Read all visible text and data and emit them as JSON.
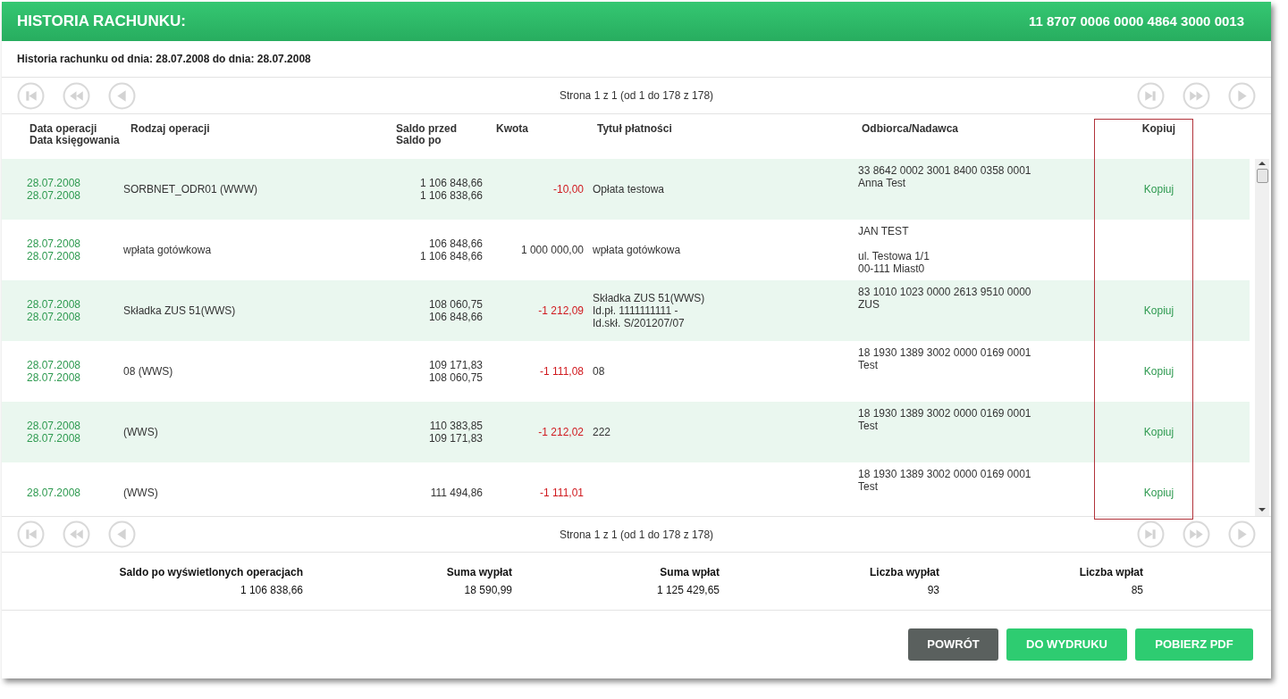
{
  "header": {
    "title": "HISTORIA RACHUNKU:",
    "account": "11 8707 0006 0000 4864 3000 0013"
  },
  "period": "Historia rachunku od dnia: 28.07.2008 do dnia: 28.07.2008",
  "pager_top": {
    "label": "Strona 1 z 1 (od 1 do 178 z 178)"
  },
  "table": {
    "columns": [
      [
        "Data operacji",
        "Data księgowania"
      ],
      [
        "Rodzaj operacji"
      ],
      [
        "Saldo przed",
        "Saldo po"
      ],
      [
        "Kwota"
      ],
      [
        "Tytuł płatności"
      ],
      [
        "Odbiorca/Nadawca"
      ],
      [
        "Kopiuj"
      ]
    ],
    "rows": [
      {
        "dates": [
          "28.07.2008",
          "28.07.2008"
        ],
        "type": "SORBNET_ODR01 (WWW)",
        "balances": [
          "1 106 848,66",
          "1 106 838,66"
        ],
        "amount": "-10,00",
        "debit": true,
        "title": [
          "Opłata testowa"
        ],
        "party": [
          [
            "33 8642 0002 3001 8400 0358 0001",
            "Anna Test"
          ]
        ],
        "copy": "Kopiuj"
      },
      {
        "dates": [
          "28.07.2008",
          "28.07.2008"
        ],
        "type": "wpłata gotówkowa",
        "balances": [
          "106 848,66",
          "1 106 848,66"
        ],
        "amount": "1 000 000,00",
        "debit": false,
        "title": [
          "wpłata gotówkowa"
        ],
        "party": [
          [
            "JAN TEST"
          ],
          [
            "ul. Testowa 1/1",
            "00-111 Miast0"
          ]
        ]
      },
      {
        "dates": [
          "28.07.2008",
          "28.07.2008"
        ],
        "type": "Składka ZUS 51(WWS)",
        "balances": [
          "108 060,75",
          "106 848,66"
        ],
        "amount": "-1 212,09",
        "debit": true,
        "title": [
          "Składka ZUS 51(WWS)",
          "Id.pł. 1111111111 -",
          "Id.skł. S/201207/07"
        ],
        "party": [
          [
            "83 1010 1023 0000 2613 9510 0000",
            "ZUS"
          ]
        ],
        "copy": "Kopiuj"
      },
      {
        "dates": [
          "28.07.2008",
          "28.07.2008"
        ],
        "type": "08 (WWS)",
        "balances": [
          "109 171,83",
          "108 060,75"
        ],
        "amount": "-1 111,08",
        "debit": true,
        "title": [
          "08"
        ],
        "party": [
          [
            "18 1930 1389 3002 0000 0169 0001",
            "Test"
          ]
        ],
        "copy": "Kopiuj"
      },
      {
        "dates": [
          "28.07.2008",
          "28.07.2008"
        ],
        "type": "(WWS)",
        "balances": [
          "110 383,85",
          "109 171,83"
        ],
        "amount": "-1 212,02",
        "debit": true,
        "title": [
          "222"
        ],
        "party": [
          [
            "18 1930 1389 3002 0000 0169 0001",
            "Test"
          ]
        ],
        "copy": "Kopiuj"
      },
      {
        "dates": [
          "28.07.2008"
        ],
        "type": "(WWS)",
        "balances": [
          "111 494,86"
        ],
        "amount": "-1 111,01",
        "debit": true,
        "party": [
          [
            "18 1930 1389 3002 0000 0169 0001",
            "Test"
          ]
        ],
        "copy": "Kopiuj"
      }
    ]
  },
  "pager_bottom": {
    "label": "Strona 1 z 1 (od 1 do 178 z 178)"
  },
  "summary": [
    {
      "label": "Saldo po wyświetlonych operacjach",
      "value": "1 106 838,66"
    },
    {
      "label": "Suma wypłat",
      "value": "18 590,99"
    },
    {
      "label": "Suma wpłat",
      "value": "1 125 429,65"
    },
    {
      "label": "Liczba wypłat",
      "value": "93"
    },
    {
      "label": "Liczba wpłat",
      "value": "85"
    }
  ],
  "buttons": [
    {
      "label": "POWRÓT",
      "kind": "secondary"
    },
    {
      "label": "DO WYDRUKU",
      "kind": "primary"
    },
    {
      "label": "POBIERZ PDF",
      "kind": "primary"
    }
  ]
}
